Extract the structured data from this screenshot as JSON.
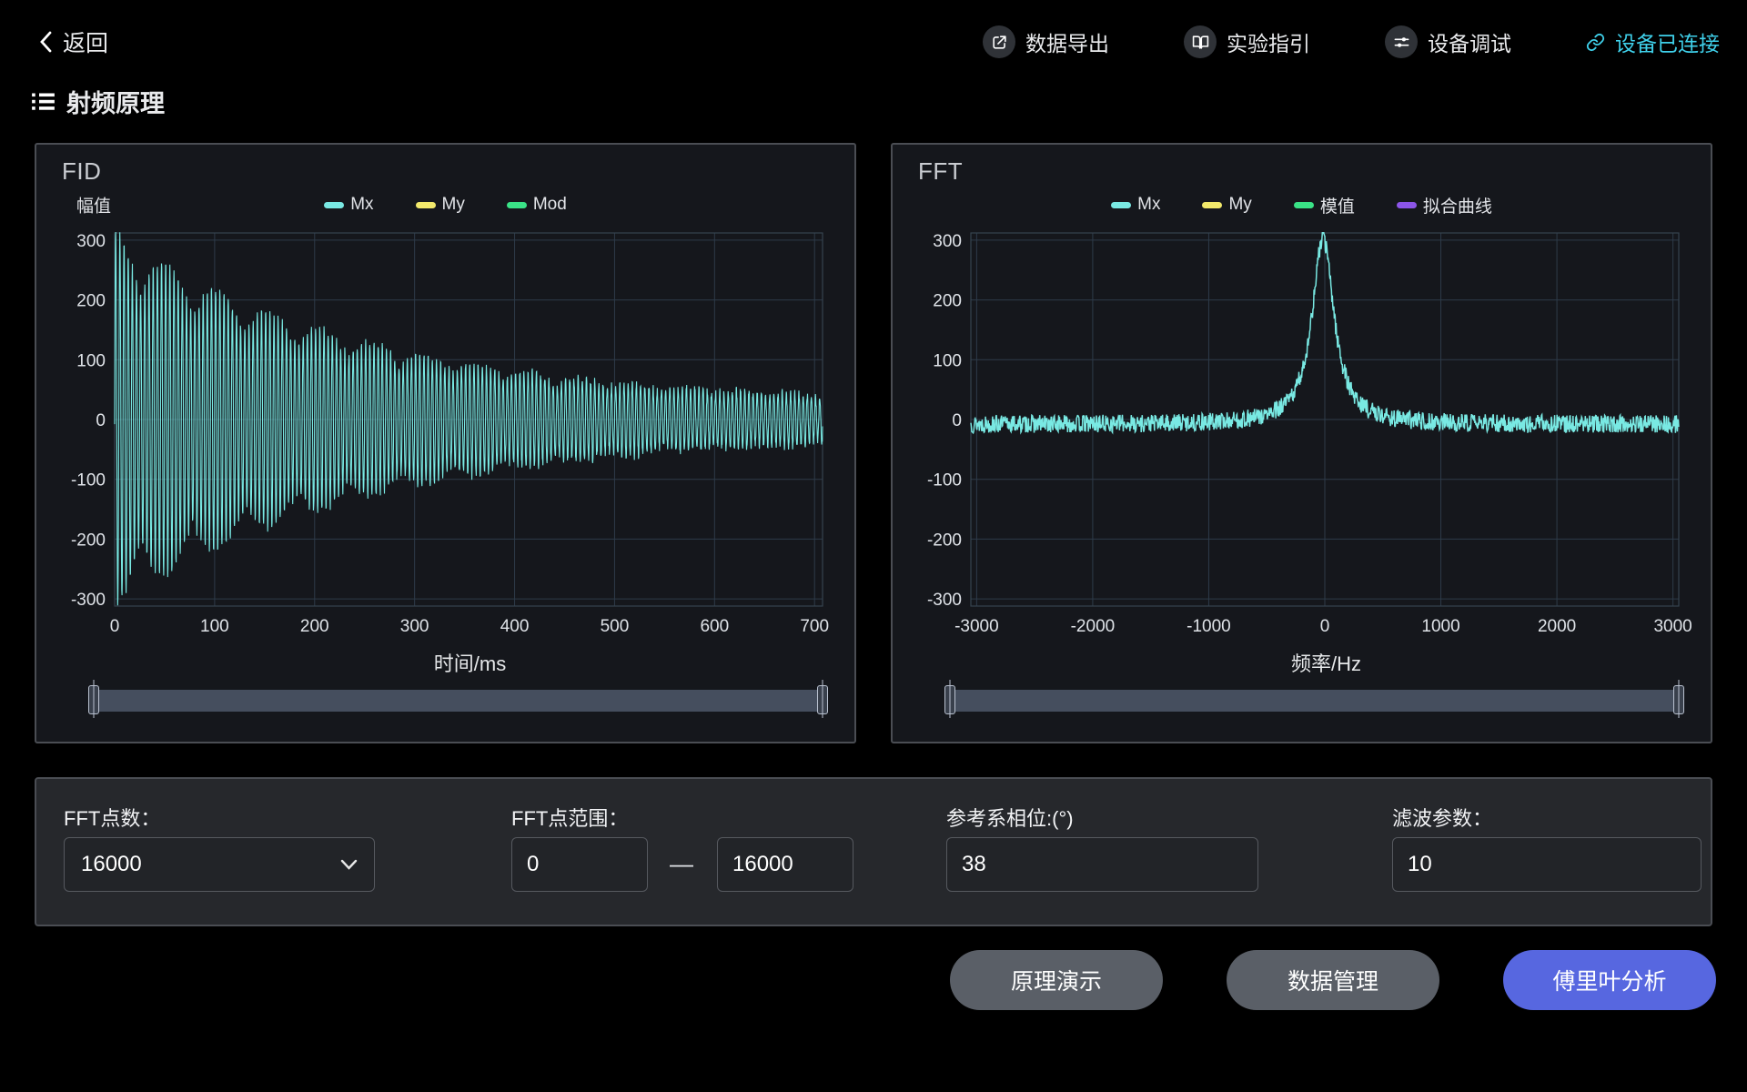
{
  "colors": {
    "status_connected": "#3fd0ea",
    "primary_button": "#5767e0",
    "gray_button": "#5a5f67",
    "series_cyan": "#79e9e3",
    "series_yellow": "#f2e96b",
    "series_green": "#3ae387",
    "series_purple": "#8c55e8"
  },
  "header": {
    "back_label": "返回",
    "nav": [
      {
        "id": "export",
        "label": "数据导出",
        "icon": "export-icon",
        "accent": false
      },
      {
        "id": "guide",
        "label": "实验指引",
        "icon": "book-icon",
        "accent": false
      },
      {
        "id": "debug",
        "label": "设备调试",
        "icon": "sliders-icon",
        "accent": false
      },
      {
        "id": "status",
        "label": "设备已连接",
        "icon": "link-icon",
        "accent": true
      }
    ]
  },
  "page": {
    "title": "射频原理"
  },
  "chart_data": [
    {
      "id": "fid",
      "type": "line",
      "title": "FID",
      "ylabel": "幅值",
      "xlabel": "时间/ms",
      "grid": true,
      "xlim": [
        0,
        708
      ],
      "ylim": [
        -312,
        312
      ],
      "x_ticks": [
        0,
        100,
        200,
        300,
        400,
        500,
        600,
        700
      ],
      "y_ticks": [
        300,
        200,
        100,
        0,
        -100,
        -200,
        -300
      ],
      "legend": [
        {
          "label": "Mx",
          "color": "#79e9e3"
        },
        {
          "label": "My",
          "color": "#f2e96b"
        },
        {
          "label": "Mod",
          "color": "#3ae387"
        }
      ],
      "series": [
        {
          "name": "Mx",
          "color": "#79e9e3",
          "model": "damped_oscillation",
          "points": 2600,
          "seed": 7,
          "amplitude": 292,
          "decay_ms": 252,
          "tail": 24,
          "freq_cycles_per_ms": 0.24,
          "beat_period_ms": 52,
          "beat_depth": 0.3,
          "noise": 8,
          "stroke_width": 1.1,
          "description": "Decaying free-induction oscillation: envelope ±300 at t=0 decaying to about ±40 at t=700 ms"
        }
      ]
    },
    {
      "id": "fft",
      "type": "line",
      "title": "FFT",
      "ylabel": "",
      "xlabel": "频率/Hz",
      "grid": true,
      "xlim": [
        -3050,
        3050
      ],
      "ylim": [
        -312,
        312
      ],
      "x_ticks": [
        -3000,
        -2000,
        -1000,
        0,
        1000,
        2000,
        3000
      ],
      "y_ticks": [
        300,
        200,
        100,
        0,
        -100,
        -200,
        -300
      ],
      "legend": [
        {
          "label": "Mx",
          "color": "#79e9e3"
        },
        {
          "label": "My",
          "color": "#f2e96b"
        },
        {
          "label": "模值",
          "color": "#3ae387"
        },
        {
          "label": "拟合曲线",
          "color": "#8c55e8"
        }
      ],
      "series": [
        {
          "name": "Mx",
          "color": "#79e9e3",
          "model": "lorentzian",
          "points": 1500,
          "seed": 13,
          "baseline": -8,
          "peak": 312,
          "center": -15,
          "hwhm": 115,
          "noise": 15,
          "stroke_width": 1.5,
          "description": "Noisy spectrum: baseline near 0 with resonance peak of ~300 at 0 Hz"
        }
      ]
    }
  ],
  "controls": {
    "fft_points": {
      "label": "FFT点数：",
      "value": "16000"
    },
    "fft_range": {
      "label": "FFT点范围：",
      "from": "0",
      "separator": "—",
      "to": "16000"
    },
    "phase": {
      "label": "参考系相位:(°)",
      "value": "38"
    },
    "filter": {
      "label": "滤波参数：",
      "value": "10"
    }
  },
  "actions": [
    {
      "id": "demo",
      "label": "原理演示",
      "style": "gray"
    },
    {
      "id": "data",
      "label": "数据管理",
      "style": "gray"
    },
    {
      "id": "fourier",
      "label": "傅里叶分析",
      "style": "primary"
    }
  ]
}
